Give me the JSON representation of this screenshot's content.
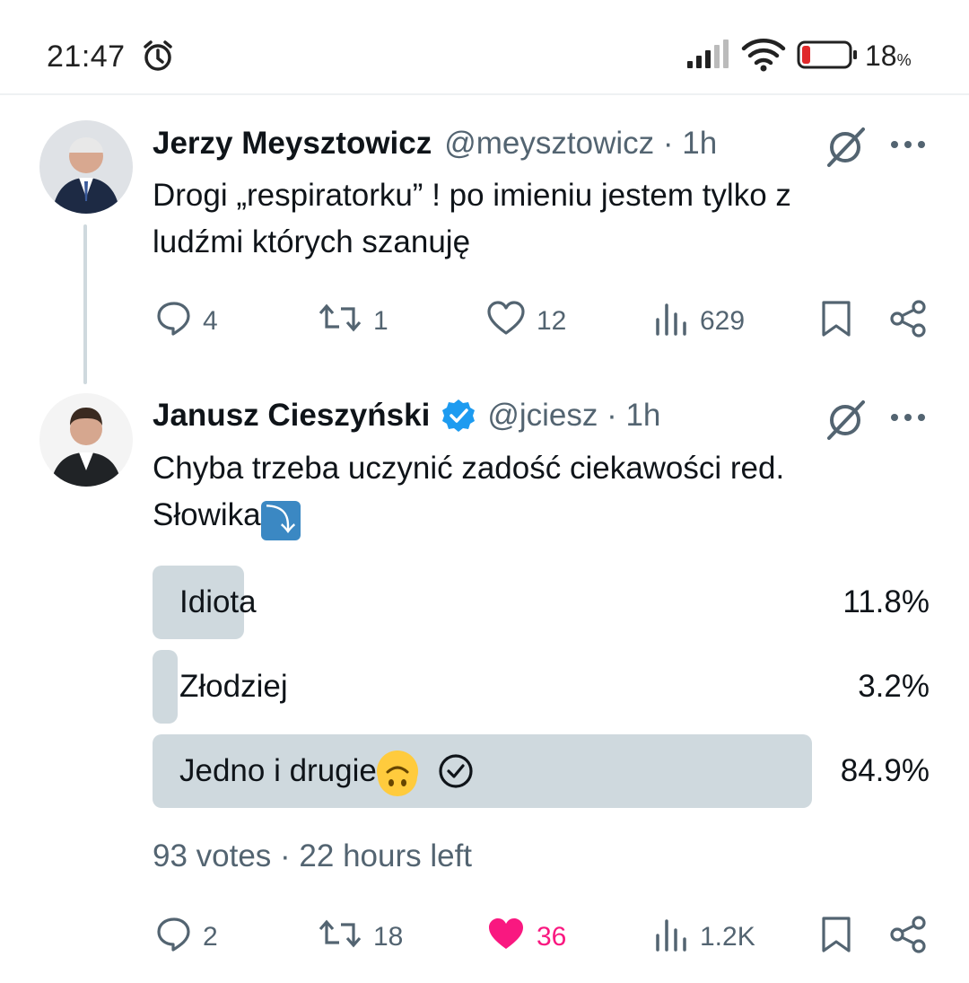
{
  "status": {
    "time": "21:47",
    "battery_pct": "18",
    "battery_pct_sign": "%",
    "battery_level": 0.18
  },
  "tweets": [
    {
      "name": "Jerzy Meysztowicz",
      "handle": "@meysztowicz · 1h",
      "text_line1": "Drogi „respiratorku” ! po imieniu jestem tylko z",
      "text_line2": "ludźmi których szanuję",
      "replies": "4",
      "retweets": "1",
      "likes": "12",
      "views": "629",
      "liked": false
    },
    {
      "name": "Janusz Cieszyński",
      "verified": true,
      "handle": "@jciesz · 1h",
      "text_line1": "Chyba trzeba uczynić zadość ciekawości red.",
      "text_line2": "Słowika",
      "replies": "2",
      "retweets": "18",
      "likes": "36",
      "views": "1.2K",
      "liked": true,
      "poll": {
        "options": [
          {
            "label": "Idiota",
            "percent_text": "11.8%",
            "percent": 11.8
          },
          {
            "label": "Złodziej",
            "percent_text": "3.2%",
            "percent": 3.2
          },
          {
            "label": "Jedno i drugie",
            "percent_text": "84.9%",
            "percent": 84.9,
            "selected": true
          }
        ],
        "meta": "93 votes · 22 hours left"
      }
    }
  ],
  "colors": {
    "like_pink": "#f91880",
    "verified_blue": "#1d9bf0",
    "muted_gray": "#536471",
    "poll_fill": "#cfd9de"
  }
}
